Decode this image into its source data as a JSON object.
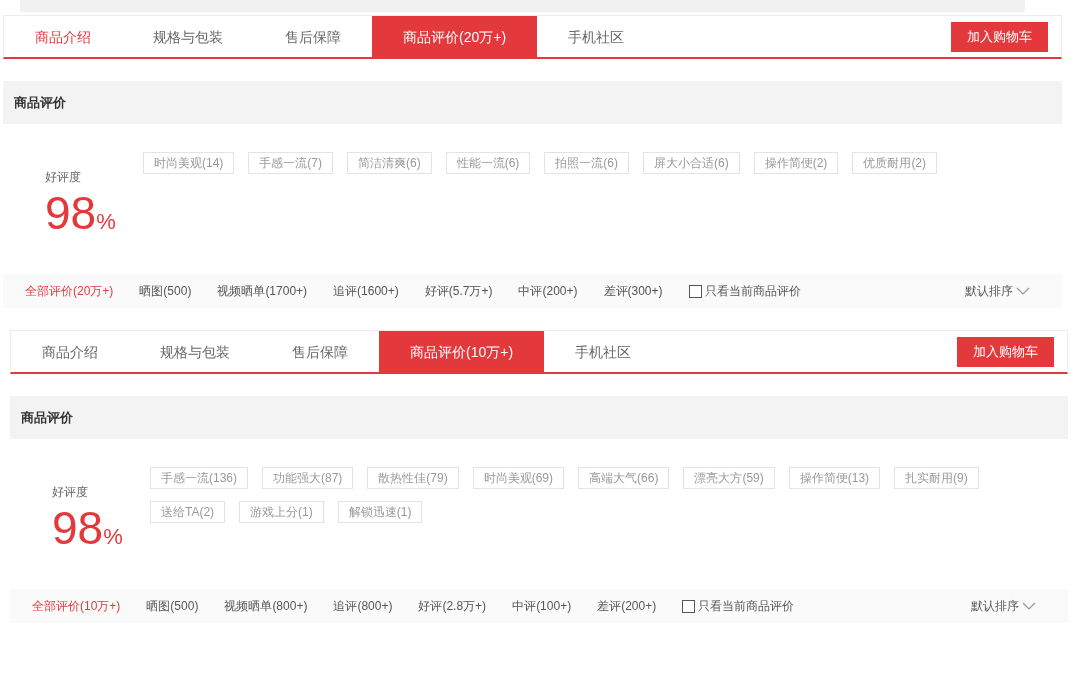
{
  "panels": [
    {
      "tabs": [
        {
          "label": "商品介绍",
          "selected": false,
          "highlighted": true
        },
        {
          "label": "规格与包装",
          "selected": false,
          "highlighted": false
        },
        {
          "label": "售后保障",
          "selected": false,
          "highlighted": false
        },
        {
          "label": "商品评价(20万+)",
          "selected": true,
          "highlighted": false
        },
        {
          "label": "手机社区",
          "selected": false,
          "highlighted": false
        }
      ],
      "cart_button": "加入购物车",
      "section_title": "商品评价",
      "rating": {
        "label": "好评度",
        "value": "98",
        "unit": "%"
      },
      "tags": [
        "时尚美观(14)",
        "手感一流(7)",
        "简洁清爽(6)",
        "性能一流(6)",
        "拍照一流(6)",
        "屏大小合适(6)",
        "操作简便(2)",
        "优质耐用(2)"
      ],
      "filters": [
        {
          "label": "全部评价(20万+)",
          "selected": true
        },
        {
          "label": "晒图(500)",
          "selected": false
        },
        {
          "label": "视频晒单(1700+)",
          "selected": false
        },
        {
          "label": "追评(1600+)",
          "selected": false
        },
        {
          "label": "好评(5.7万+)",
          "selected": false
        },
        {
          "label": "中评(200+)",
          "selected": false
        },
        {
          "label": "差评(300+)",
          "selected": false
        }
      ],
      "only_current": {
        "label": "只看当前商品评价",
        "checked": false
      },
      "sort": {
        "label": "默认排序"
      }
    },
    {
      "tabs": [
        {
          "label": "商品介绍",
          "selected": false,
          "highlighted": false
        },
        {
          "label": "规格与包装",
          "selected": false,
          "highlighted": false
        },
        {
          "label": "售后保障",
          "selected": false,
          "highlighted": false
        },
        {
          "label": "商品评价(10万+)",
          "selected": true,
          "highlighted": false
        },
        {
          "label": "手机社区",
          "selected": false,
          "highlighted": false
        }
      ],
      "cart_button": "加入购物车",
      "section_title": "商品评价",
      "rating": {
        "label": "好评度",
        "value": "98",
        "unit": "%"
      },
      "tags": [
        "手感一流(136)",
        "功能强大(87)",
        "散热性佳(79)",
        "时尚美观(69)",
        "高端大气(66)",
        "漂亮大方(59)",
        "操作简便(13)",
        "扎实耐用(9)",
        "送给TA(2)",
        "游戏上分(1)",
        "解锁迅速(1)"
      ],
      "filters": [
        {
          "label": "全部评价(10万+)",
          "selected": true
        },
        {
          "label": "晒图(500)",
          "selected": false
        },
        {
          "label": "视频晒单(800+)",
          "selected": false
        },
        {
          "label": "追评(800+)",
          "selected": false
        },
        {
          "label": "好评(2.8万+)",
          "selected": false
        },
        {
          "label": "中评(100+)",
          "selected": false
        },
        {
          "label": "差评(200+)",
          "selected": false
        }
      ],
      "only_current": {
        "label": "只看当前商品评价",
        "checked": false
      },
      "sort": {
        "label": "默认排序"
      }
    }
  ]
}
